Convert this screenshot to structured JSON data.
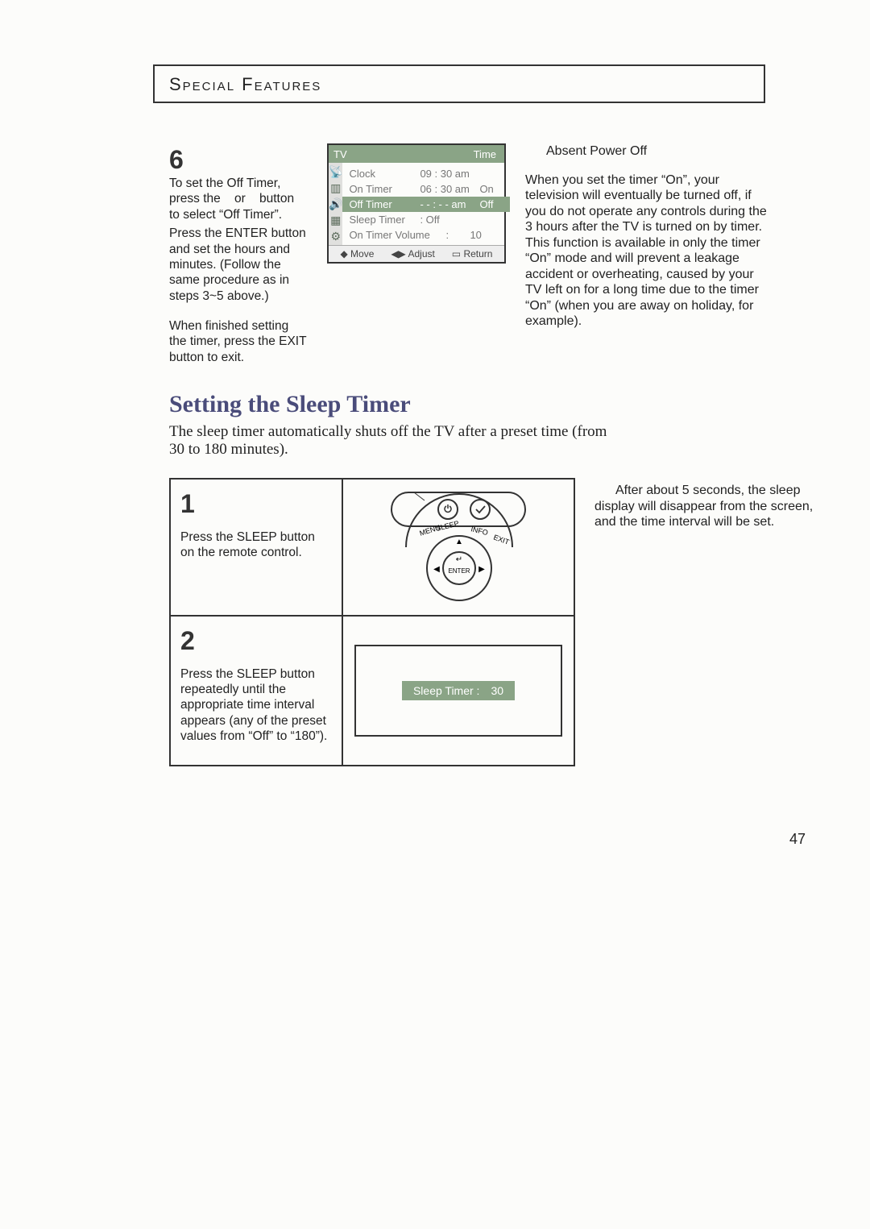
{
  "chapter_title": "Special Features",
  "step6": {
    "num": "6",
    "para1": "To set the Off Timer, press the    or    button to select “Off Timer”.",
    "para2": "Press the ENTER button and set the hours and minutes. (Follow the same procedure as in steps 3~5 above.)",
    "para3": "When finished setting the timer, press the EXIT button to exit."
  },
  "osd": {
    "tab": "TV",
    "title_right": "Time",
    "rows": [
      {
        "c1": "Clock",
        "c2": "09 : 30 am",
        "c3": ""
      },
      {
        "c1": "On Timer",
        "c2": "06 : 30 am",
        "c3": "On"
      },
      {
        "c1": "Off Timer",
        "c2": "- - : - - am",
        "c3": "Off",
        "selected": true
      },
      {
        "c1": "Sleep Timer",
        "c2": ": Off",
        "c3": ""
      },
      {
        "c1": "On Timer Volume",
        "c2": ":",
        "c3": "10"
      }
    ],
    "foot": {
      "move": "Move",
      "adjust": "Adjust",
      "return": "Return"
    }
  },
  "absent": {
    "title": "Absent Power Off",
    "body": "When you set the timer “On”, your television will eventually be turned off, if you do not operate any controls during the 3 hours after the TV is turned on by timer.\nThis function is available in only the timer “On” mode and will prevent a leakage accident or overheating, caused by your TV left on for a long time due to the timer “On” (when you are away on holiday, for example)."
  },
  "sleep": {
    "heading": "Setting the Sleep Timer",
    "intro": "The sleep timer automatically shuts off the TV after a preset time (from 30 to 180 minutes).",
    "step1": {
      "num": "1",
      "text": "Press the SLEEP button on the remote control."
    },
    "step2": {
      "num": "2",
      "text": "Press the SLEEP button repeatedly until the appropriate time interval appears (any of the preset values from “Off” to “180”)."
    },
    "osd_label": "Sleep Timer    :",
    "osd_value": "30",
    "note": "After about 5 seconds, the sleep display will disappear from the screen, and the time interval will be set."
  },
  "remote_labels": {
    "sleep": "SLEEP",
    "info": "INFO",
    "menu": "MENU",
    "exit": "EXIT",
    "enter": "ENTER"
  },
  "page_number": "47"
}
